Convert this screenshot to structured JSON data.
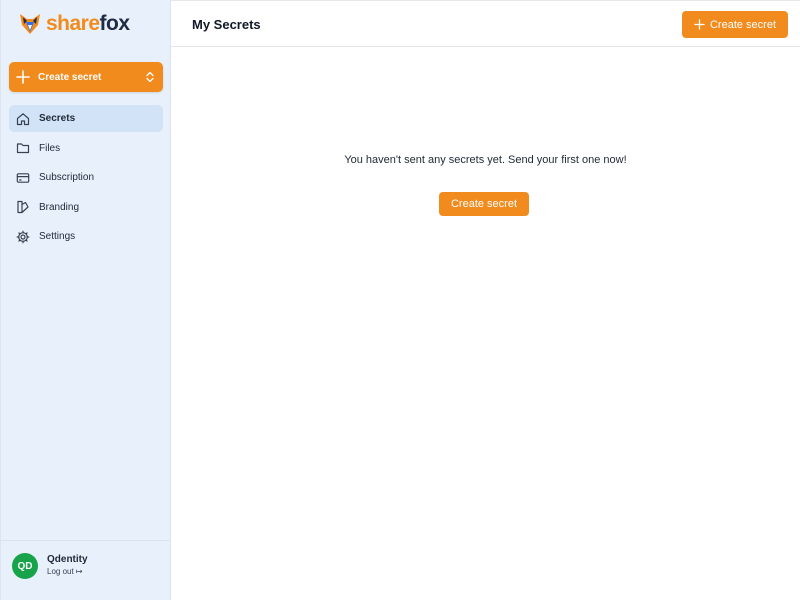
{
  "brand": {
    "part1": "share",
    "part2": "fox",
    "accent": "#f28b1d",
    "dark": "#1f2a44"
  },
  "sidebar": {
    "create_button": {
      "label": "Create secret",
      "icon": "plus-icon",
      "toggle_icon": "chevron-updown-icon"
    },
    "items": [
      {
        "label": "Secrets",
        "icon": "home-icon",
        "active": true
      },
      {
        "label": "Files",
        "icon": "folder-icon",
        "active": false
      },
      {
        "label": "Subscription",
        "icon": "credit-card-icon",
        "active": false
      },
      {
        "label": "Branding",
        "icon": "branding-icon",
        "active": false
      },
      {
        "label": "Settings",
        "icon": "gear-icon",
        "active": false
      }
    ],
    "user": {
      "initials": "QD",
      "name": "Qdentity",
      "logout": "Log out ↦",
      "avatar_color": "#16a34a"
    }
  },
  "header": {
    "title": "My Secrets",
    "create_button": "Create secret"
  },
  "main": {
    "empty_message": "You haven't sent any secrets yet. Send your first one now!",
    "create_button": "Create secret"
  }
}
